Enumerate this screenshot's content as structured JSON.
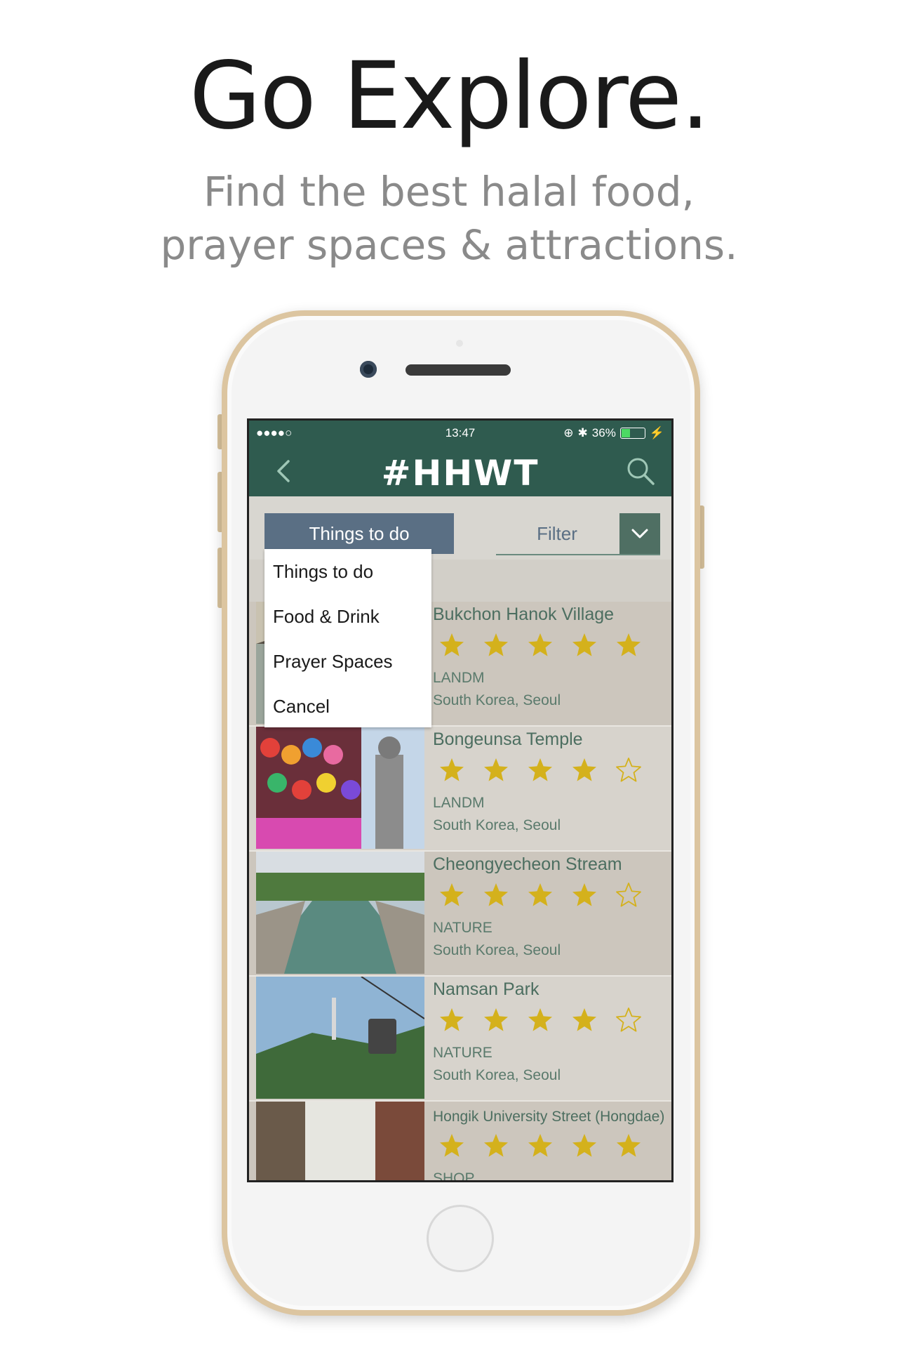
{
  "promo": {
    "headline": "Go Explore.",
    "subline_1": "Find the best halal food,",
    "subline_2": "prayer spaces & attractions."
  },
  "status_bar": {
    "signal": "●●●●○",
    "time": "13:47",
    "battery": "36%",
    "battery_level": 0.36
  },
  "nav": {
    "brand": "#HHWT"
  },
  "filters": {
    "category_selected": "Things to do",
    "filter_label": "Filter"
  },
  "dropdown": {
    "options": [
      "Things to do",
      "Food & Drink",
      "Prayer Spaces",
      "Cancel"
    ]
  },
  "places": [
    {
      "name": "Bukchon Hanok Village",
      "rating": 5,
      "category": "LANDM",
      "location": "South Korea, Seoul"
    },
    {
      "name": "Bongeunsa Temple",
      "rating": 4,
      "category": "LANDM",
      "location": "South Korea, Seoul"
    },
    {
      "name": "Cheongyecheon Stream",
      "rating": 4,
      "category": "NATURE",
      "location": "South Korea, Seoul"
    },
    {
      "name": "Namsan Park",
      "rating": 4,
      "category": "NATURE",
      "location": "South Korea, Seoul"
    },
    {
      "name": "Hongik University Street (Hongdae)",
      "rating": 5,
      "category": "SHOP",
      "location": ""
    }
  ],
  "colors": {
    "header_green": "#2f5b4f",
    "star_gold": "#d4b11c",
    "category_button": "#5a6f84"
  }
}
